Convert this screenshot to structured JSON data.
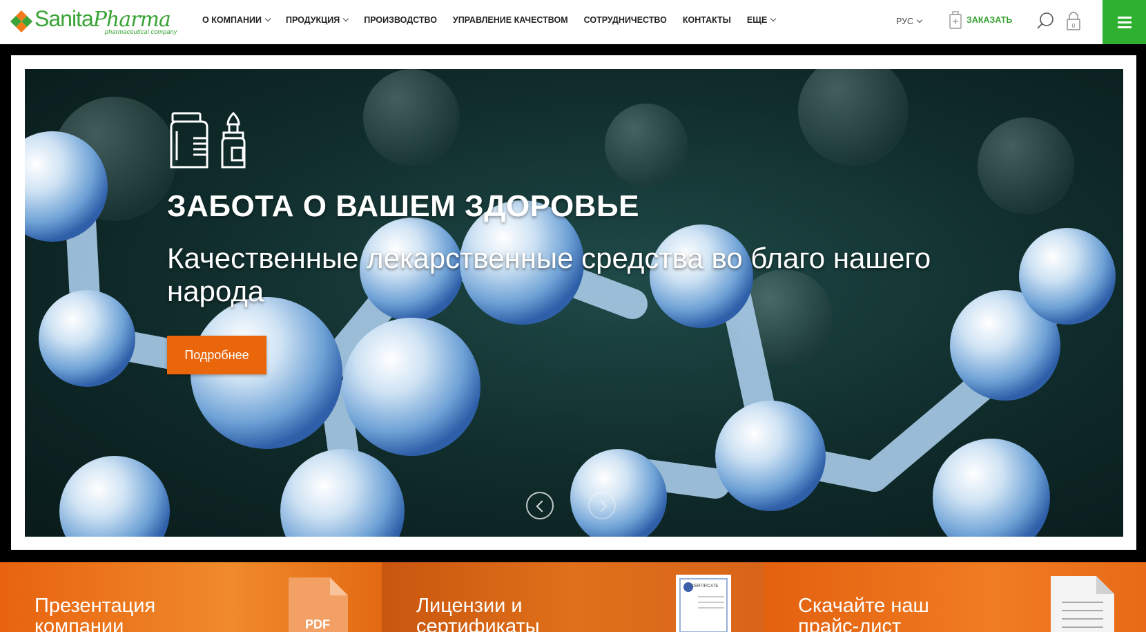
{
  "header": {
    "logo": {
      "brand_part1": "Sanita",
      "brand_part2": "Pharma",
      "tagline": "pharmaceutical company"
    },
    "nav": [
      {
        "label": "О КОМПАНИИ",
        "has_dropdown": true
      },
      {
        "label": "ПРОДУКЦИЯ",
        "has_dropdown": true
      },
      {
        "label": "ПРОИЗВОДСТВО",
        "has_dropdown": false
      },
      {
        "label": "УПРАВЛЕНИЕ КАЧЕСТВОМ",
        "has_dropdown": false
      },
      {
        "label": "СОТРУДНИЧЕСТВО",
        "has_dropdown": false
      },
      {
        "label": "КОНТАКТЫ",
        "has_dropdown": false
      },
      {
        "label": "ЕЩЕ",
        "has_dropdown": true
      }
    ],
    "language": "РУС",
    "order_label": "ЗАКАЗАТЬ",
    "cart_count": "0",
    "icons": {
      "search": "search-icon",
      "cart": "lock-cart-icon",
      "menu": "hamburger-menu-icon",
      "order": "medicine-bag-icon"
    }
  },
  "hero": {
    "title": "ЗАБОТА О ВАШЕМ ЗДОРОВЬЕ",
    "subtitle": "Качественные лекарственные средства во благо нашего народа",
    "button_label": "Подробнее",
    "icons": [
      "pill-bottle-icon",
      "dropper-bottle-icon"
    ]
  },
  "promos": [
    {
      "label": "Презентация компании",
      "doc_label": "PDF",
      "icon": "pdf-document-icon"
    },
    {
      "label": "Лицензии и сертификаты",
      "doc_label": "CERTIFICATE",
      "icon": "certificate-icon"
    },
    {
      "label": "Скачайте наш прайс-лист",
      "doc_label": "",
      "icon": "document-icon"
    }
  ],
  "colors": {
    "brand_green": "#3aa335",
    "menu_green": "#2fb031",
    "accent_orange": "#e9660b",
    "promo_orange": "#f07a1a"
  }
}
